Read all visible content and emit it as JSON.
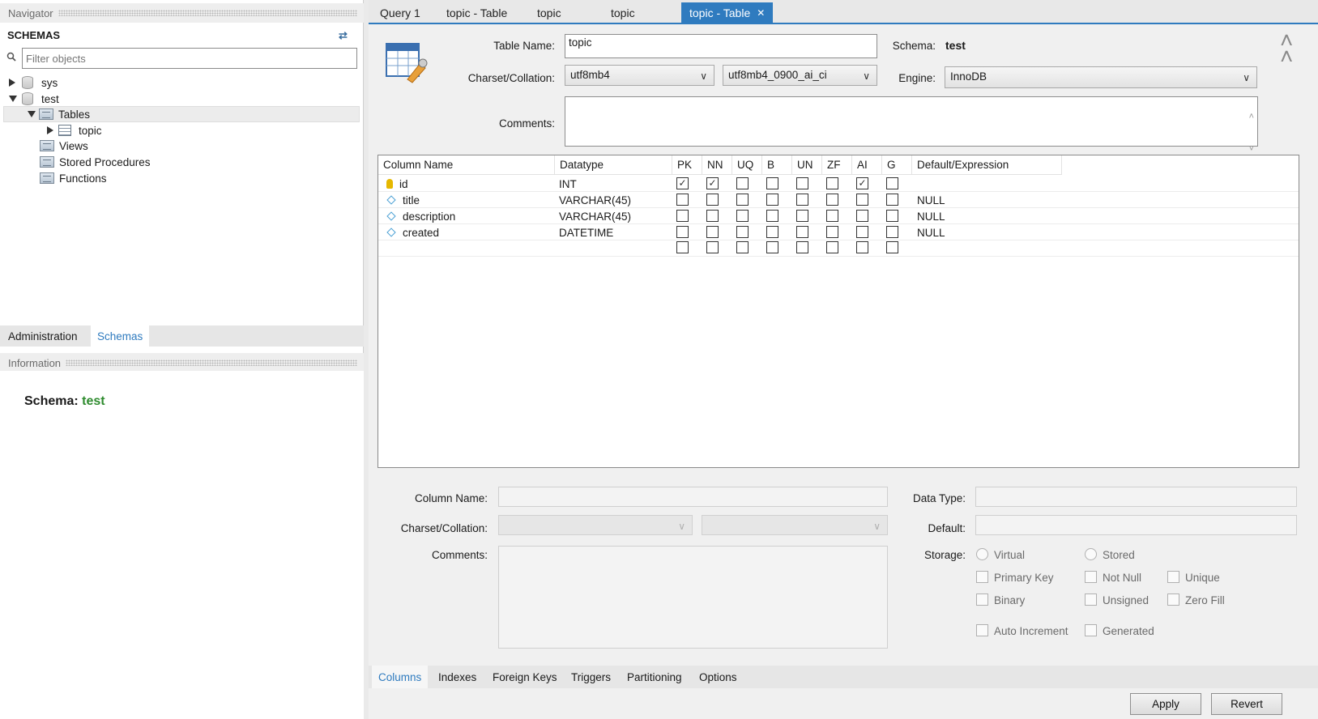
{
  "navigator": {
    "header": "Navigator",
    "schemas_title": "SCHEMAS",
    "filter_placeholder": "Filter objects",
    "tree": {
      "sys": "sys",
      "test": "test",
      "tables": "Tables",
      "topic": "topic",
      "views": "Views",
      "stored_procedures": "Stored Procedures",
      "functions": "Functions"
    },
    "tabs": [
      "Administration",
      "Schemas"
    ],
    "information_header": "Information",
    "info": {
      "label": "Schema:",
      "value": "test"
    }
  },
  "editor_tabs": [
    "Query 1",
    "topic - Table",
    "topic",
    "topic",
    "topic - Table"
  ],
  "table_form": {
    "table_name_label": "Table Name:",
    "table_name": "topic",
    "schema_label": "Schema:",
    "schema_value": "test",
    "charset_label": "Charset/Collation:",
    "charset": "utf8mb4",
    "collation": "utf8mb4_0900_ai_ci",
    "engine_label": "Engine:",
    "engine": "InnoDB",
    "comments_label": "Comments:"
  },
  "grid": {
    "headers": [
      "Column Name",
      "Datatype",
      "PK",
      "NN",
      "UQ",
      "B",
      "UN",
      "ZF",
      "AI",
      "G",
      "Default/Expression"
    ],
    "rows": [
      {
        "name": "id",
        "type": "INT",
        "default": ""
      },
      {
        "name": "title",
        "type": "VARCHAR(45)",
        "default": "NULL"
      },
      {
        "name": "description",
        "type": "VARCHAR(45)",
        "default": "NULL"
      },
      {
        "name": "created",
        "type": "DATETIME",
        "default": "NULL"
      }
    ]
  },
  "details": {
    "column_name_label": "Column Name:",
    "charset_label": "Charset/Collation:",
    "comments_label": "Comments:",
    "data_type_label": "Data Type:",
    "default_label": "Default:",
    "storage_label": "Storage:",
    "virtual": "Virtual",
    "stored": "Stored",
    "primary_key": "Primary Key",
    "not_null": "Not Null",
    "unique": "Unique",
    "binary": "Binary",
    "unsigned": "Unsigned",
    "zero_fill": "Zero Fill",
    "auto_increment": "Auto Increment",
    "generated": "Generated"
  },
  "bottom_tabs": [
    "Columns",
    "Indexes",
    "Foreign Keys",
    "Triggers",
    "Partitioning",
    "Options"
  ],
  "buttons": {
    "apply": "Apply",
    "revert": "Revert"
  }
}
